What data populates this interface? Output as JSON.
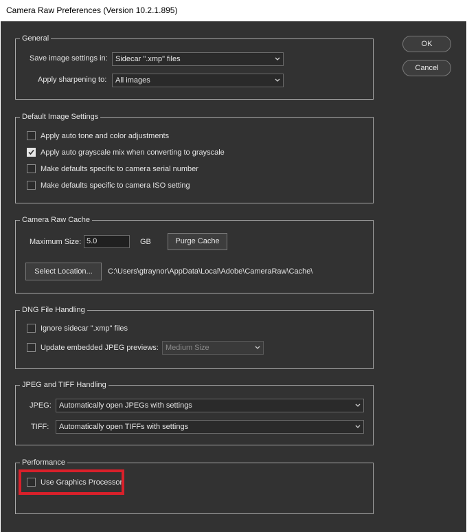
{
  "window": {
    "title": "Camera Raw Preferences  (Version 10.2.1.895)"
  },
  "actions": {
    "ok_label": "OK",
    "cancel_label": "Cancel"
  },
  "general": {
    "legend": "General",
    "save_settings_label": "Save image settings in:",
    "save_settings_value": "Sidecar \".xmp\" files",
    "apply_sharpening_label": "Apply sharpening to:",
    "apply_sharpening_value": "All images"
  },
  "default_image_settings": {
    "legend": "Default Image Settings",
    "options": [
      {
        "label": "Apply auto tone and color adjustments",
        "checked": false
      },
      {
        "label": "Apply auto grayscale mix when converting to grayscale",
        "checked": true
      },
      {
        "label": "Make defaults specific to camera serial number",
        "checked": false
      },
      {
        "label": "Make defaults specific to camera ISO setting",
        "checked": false
      }
    ]
  },
  "cache": {
    "legend": "Camera Raw Cache",
    "max_size_label": "Maximum Size:",
    "max_size_value": "5.0",
    "unit": "GB",
    "purge_label": "Purge Cache",
    "select_location_label": "Select Location...",
    "path": "C:\\Users\\gtraynor\\AppData\\Local\\Adobe\\CameraRaw\\Cache\\"
  },
  "dng": {
    "legend": "DNG File Handling",
    "ignore_sidecar_label": "Ignore sidecar \".xmp\" files",
    "ignore_sidecar_checked": false,
    "update_previews_label": "Update embedded JPEG previews:",
    "update_previews_checked": false,
    "preview_size_value": "Medium Size"
  },
  "jpeg_tiff": {
    "legend": "JPEG and TIFF Handling",
    "jpeg_label": "JPEG:",
    "jpeg_value": "Automatically open JPEGs with settings",
    "tiff_label": "TIFF:",
    "tiff_value": "Automatically open TIFFs with settings"
  },
  "performance": {
    "legend": "Performance",
    "gpu_label": "Use Graphics Processor",
    "gpu_checked": false
  },
  "colors": {
    "background": "#323232",
    "highlight": "#d9202a"
  }
}
